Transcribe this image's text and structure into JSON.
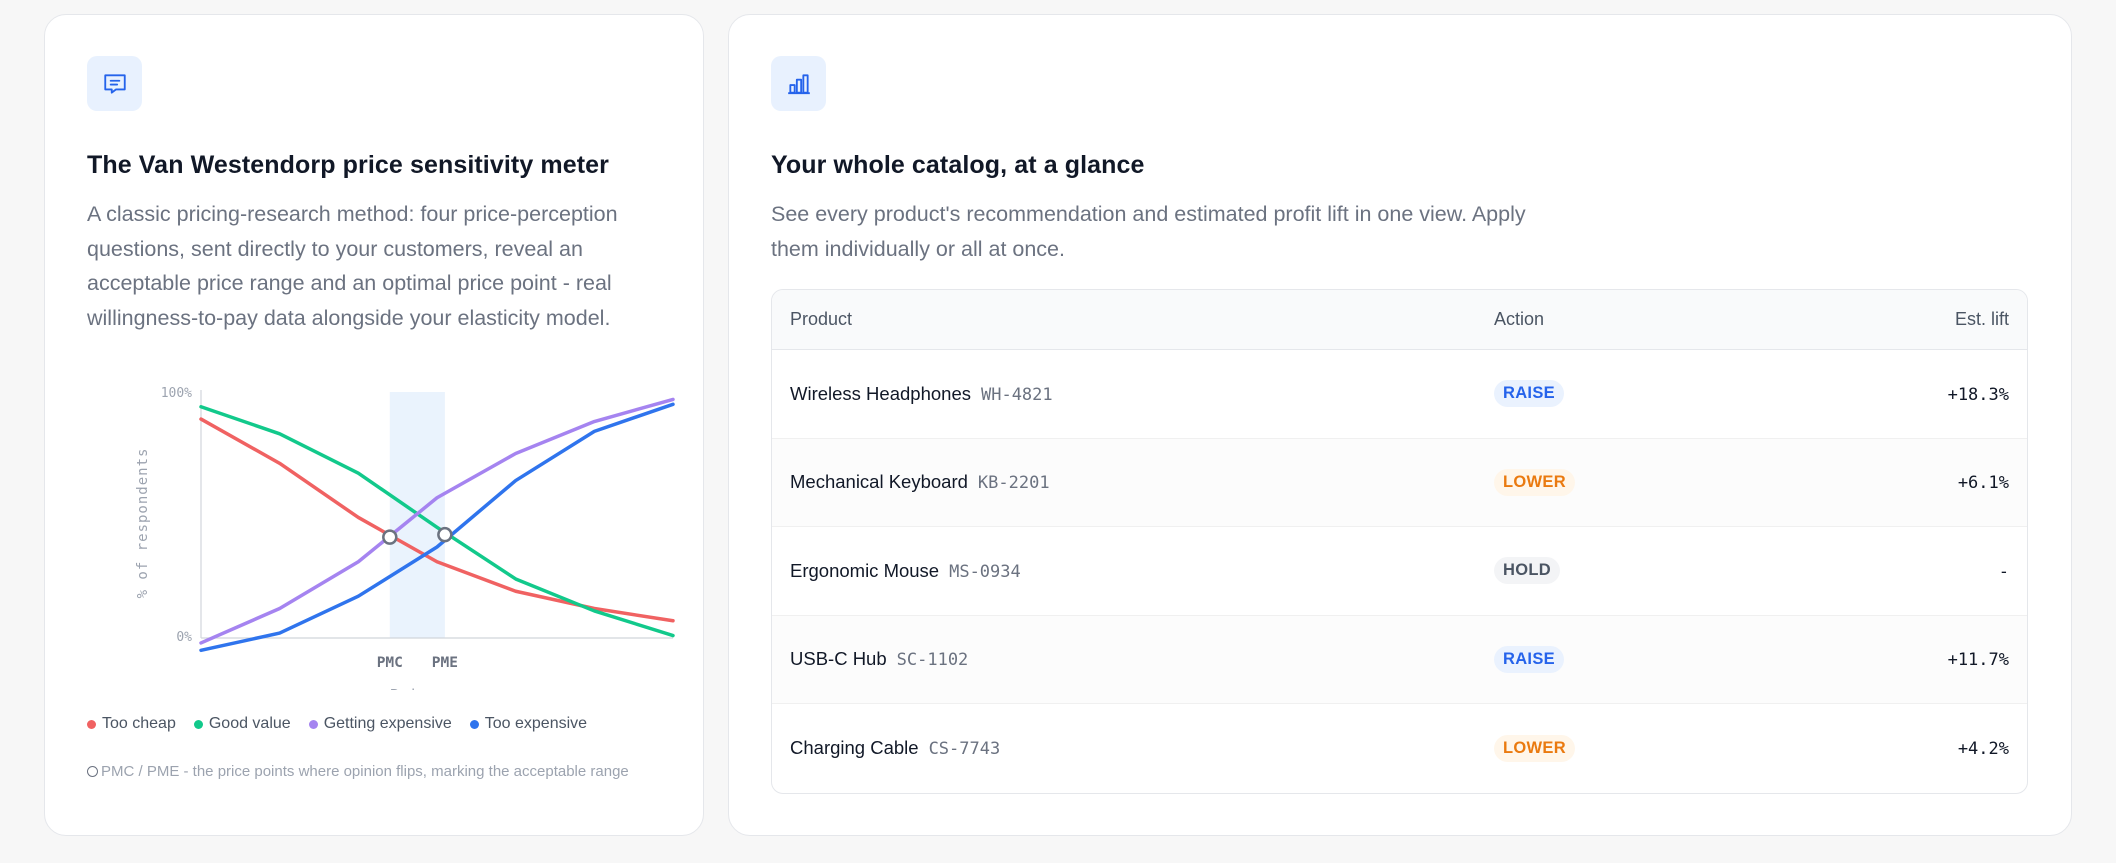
{
  "left_card": {
    "icon": "message-square-icon",
    "title": "The Van Westendorp price sensitivity meter",
    "description": "A classic pricing-research method: four price-perception questions, sent directly to your customers, reveal an acceptable price range and an optimal price point - real willingness-to-pay data alongside your elasticity model.",
    "footnote": "PMC / PME - the price points where opinion flips, marking the acceptable range"
  },
  "chart_data": {
    "type": "line",
    "title": "",
    "xlabel": "Price ⟶",
    "ylabel": "% of respondents",
    "y_ticks": [
      "100%",
      "0%"
    ],
    "ylim": [
      0,
      100
    ],
    "x": [
      0,
      1,
      2,
      3,
      4,
      5,
      6,
      7,
      8
    ],
    "markers": [
      {
        "label": "PMC",
        "x": 2.4
      },
      {
        "label": "PME",
        "x": 3.1
      }
    ],
    "band": [
      2.4,
      3.1
    ],
    "series": [
      {
        "name": "Too cheap",
        "color": "#f06262",
        "values": [
          89,
          71,
          49,
          31,
          19,
          12,
          7
        ]
      },
      {
        "name": "Good value",
        "color": "#12c98b",
        "values": [
          94,
          83,
          67,
          45,
          24,
          11,
          1
        ]
      },
      {
        "name": "Getting expensive",
        "color": "#a584f0",
        "values": [
          -2,
          12,
          31,
          57,
          75,
          88,
          97
        ]
      },
      {
        "name": "Too expensive",
        "color": "#2f74ed",
        "values": [
          -5,
          2,
          17,
          37,
          64,
          84,
          95
        ]
      }
    ],
    "legend_position": "bottom"
  },
  "right_card": {
    "icon": "bar-chart-icon",
    "title": "Your whole catalog, at a glance",
    "description": "See every product's recommendation and estimated profit lift in one view. Apply them individually or all at once."
  },
  "table": {
    "headers": [
      "Product",
      "Action",
      "Est. lift"
    ],
    "rows": [
      {
        "name": "Wireless Headphones",
        "sku": "WH-4821",
        "action": "RAISE",
        "lift": "+18.3%"
      },
      {
        "name": "Mechanical Keyboard",
        "sku": "KB-2201",
        "action": "LOWER",
        "lift": "+6.1%"
      },
      {
        "name": "Ergonomic Mouse",
        "sku": "MS-0934",
        "action": "HOLD",
        "lift": "-"
      },
      {
        "name": "USB-C Hub",
        "sku": "SC-1102",
        "action": "RAISE",
        "lift": "+11.7%"
      },
      {
        "name": "Charging Cable",
        "sku": "CS-7743",
        "action": "LOWER",
        "lift": "+4.2%"
      }
    ]
  }
}
